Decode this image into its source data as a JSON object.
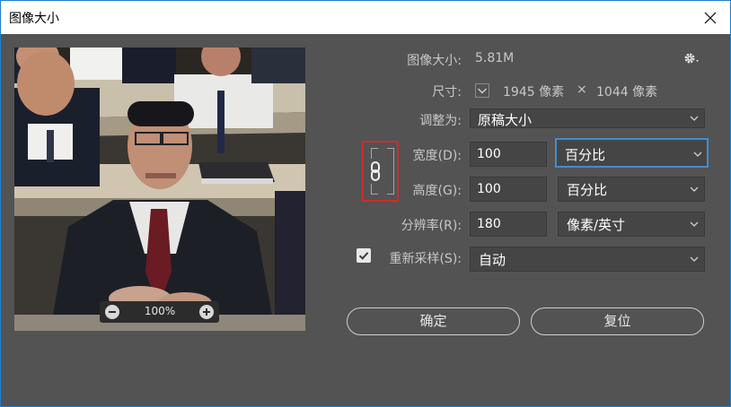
{
  "window": {
    "title": "图像大小"
  },
  "preview": {
    "zoom": "100%"
  },
  "form": {
    "image_size_label": "图像大小:",
    "image_size_value": "5.81M",
    "dimensions_label": "尺寸:",
    "dimensions_width": "1945 像素",
    "dimensions_times": "×",
    "dimensions_height": "1044 像素",
    "fit_to_label": "调整为:",
    "fit_to_value": "原稿大小",
    "width_label": "宽度(D):",
    "width_value": "100",
    "width_unit": "百分比",
    "height_label": "高度(G):",
    "height_value": "100",
    "height_unit": "百分比",
    "resolution_label": "分辨率(R):",
    "resolution_value": "180",
    "resolution_unit": "像素/英寸",
    "resample_label": "重新采样(S):",
    "resample_checked": true,
    "resample_value": "自动"
  },
  "buttons": {
    "ok": "确定",
    "reset": "复位"
  },
  "colors": {
    "dialog_bg": "#535353",
    "focus_outline": "#3e8ed6",
    "link_highlight": "#d22a2a",
    "window_border": "#1e7fcc"
  },
  "icons": {
    "close": "close-icon",
    "gear": "gear-icon",
    "zoom_out": "zoom-out-icon",
    "zoom_in": "zoom-in-icon",
    "link": "chain-link-icon",
    "dimensions_toggle": "chevron-down-icon"
  }
}
